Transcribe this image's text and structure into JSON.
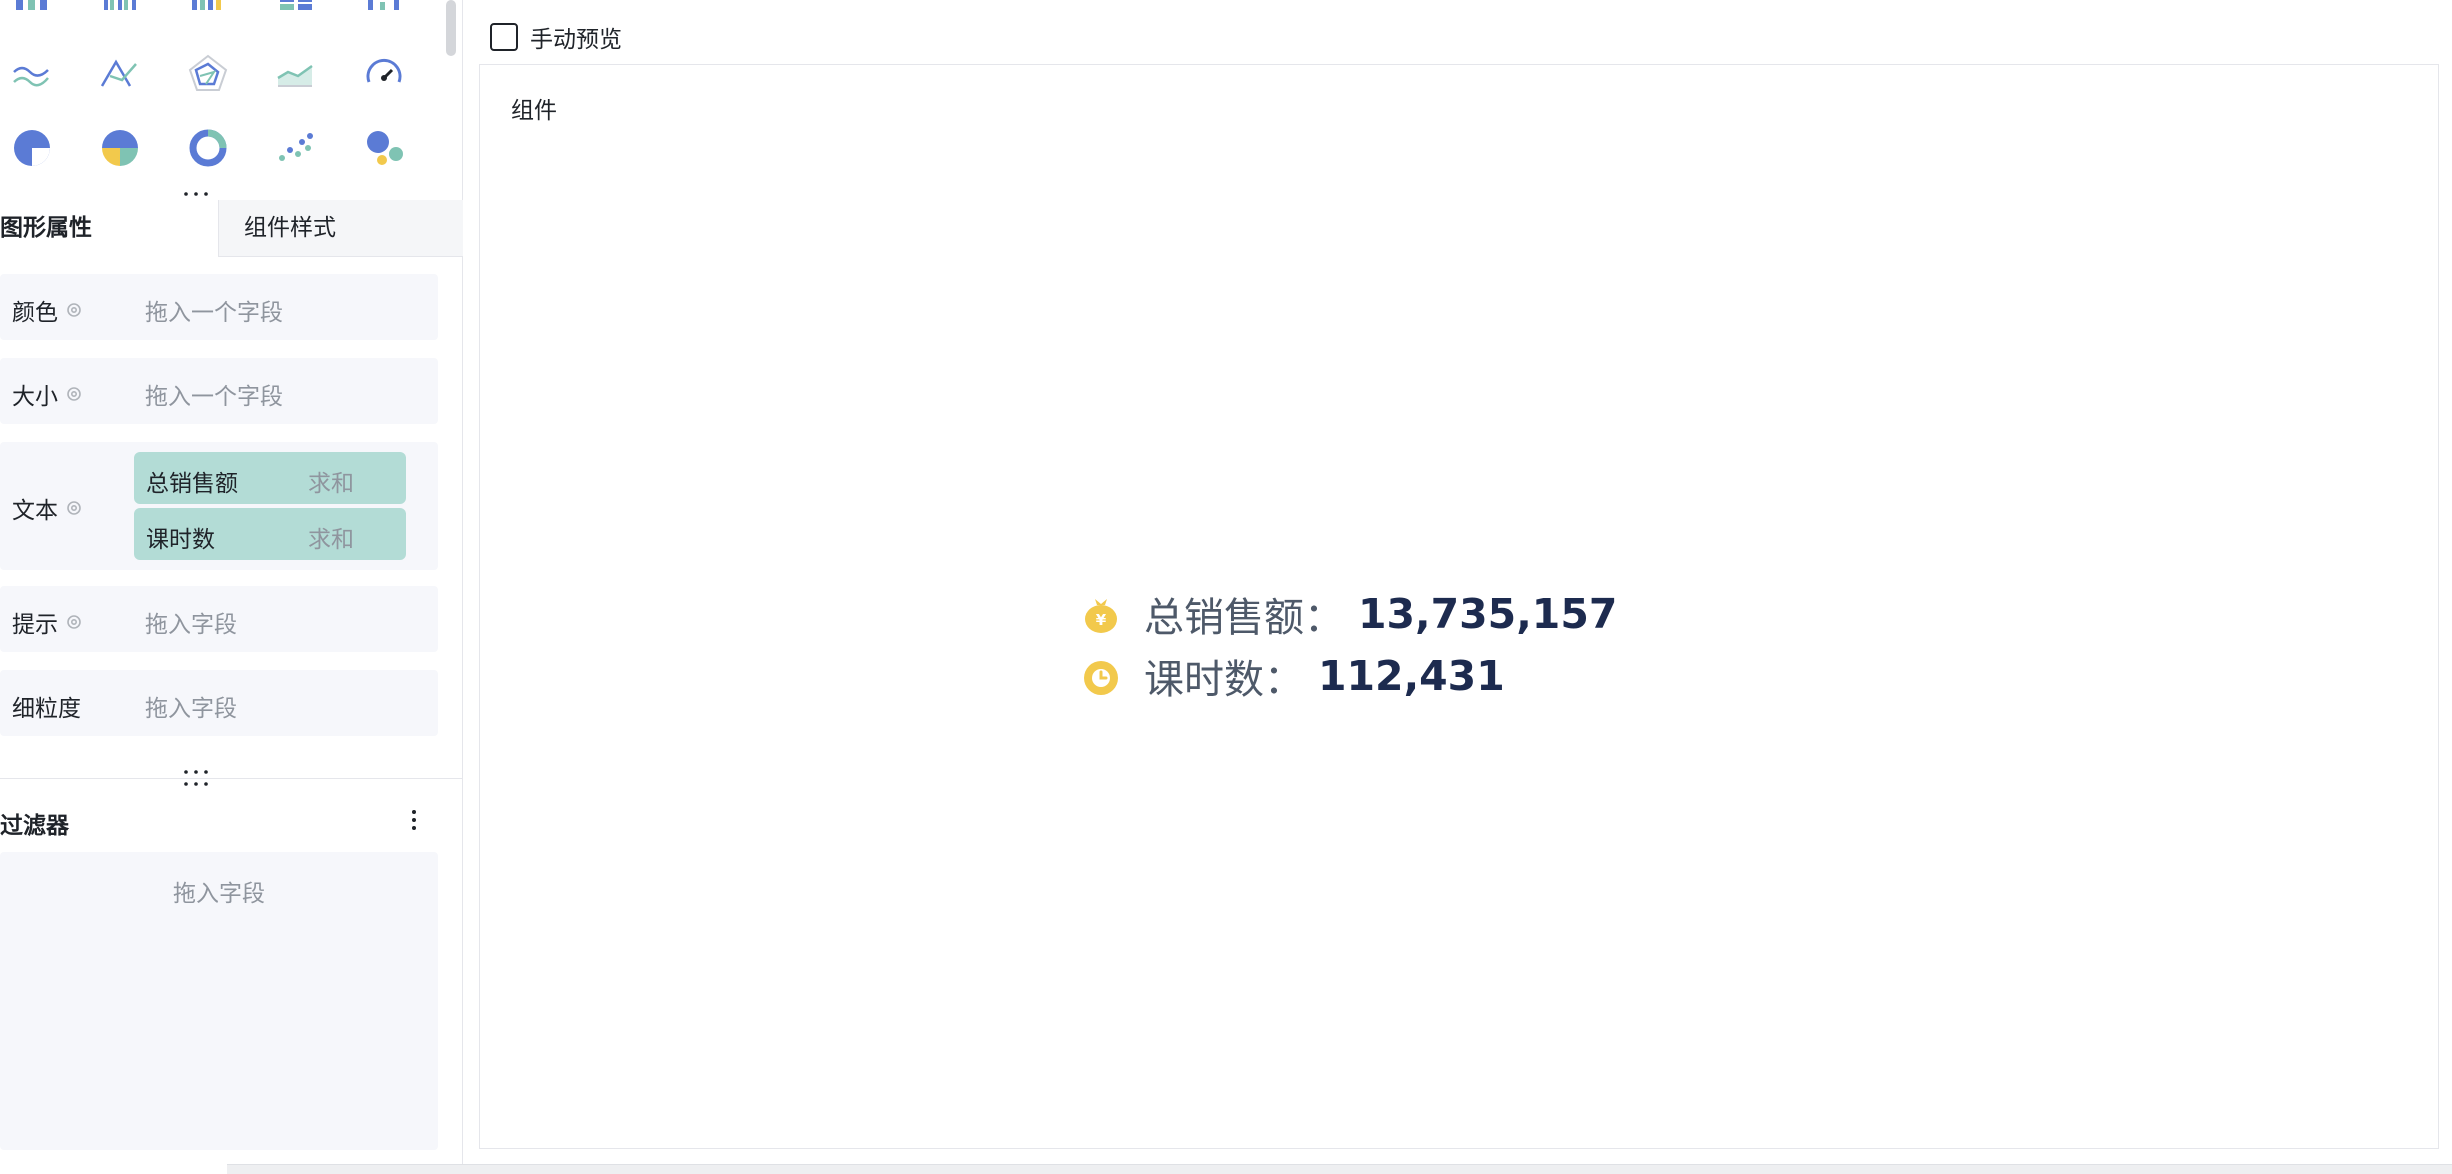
{
  "tabs": {
    "active": "图形属性",
    "inactive": "组件样式"
  },
  "chart_types": [
    "bar-chart-icon",
    "grouped-bar-chart-icon",
    "multi-bar-chart-icon",
    "layout-bar-chart-icon",
    "step-chart-icon",
    "wave-line-chart-icon",
    "cross-line-chart-icon",
    "radar-chart-icon",
    "area-chart-icon",
    "gauge-chart-icon",
    "pie-chart-icon",
    "quadrant-pie-chart-icon",
    "donut-chart-icon",
    "scatter-chart-icon",
    "bubble-chart-icon"
  ],
  "properties": {
    "color": {
      "label": "颜色",
      "placeholder": "拖入一个字段"
    },
    "size": {
      "label": "大小",
      "placeholder": "拖入一个字段"
    },
    "text": {
      "label": "文本",
      "fields": [
        {
          "name": "总销售额",
          "agg": "求和"
        },
        {
          "name": "课时数",
          "agg": "求和"
        }
      ]
    },
    "tooltip": {
      "label": "提示",
      "placeholder": "拖入字段"
    },
    "granularity": {
      "label": "细粒度",
      "placeholder": "拖入字段"
    }
  },
  "filter": {
    "title": "过滤器",
    "placeholder": "拖入字段"
  },
  "preview": {
    "label": "手动预览",
    "checked": false
  },
  "canvas": {
    "component_label": "组件",
    "kpis": [
      {
        "label": "总销售额",
        "colon": "：",
        "value": "13,735,157",
        "icon": "money-bag-icon"
      },
      {
        "label": "课时数",
        "colon": "：",
        "value": "112,431",
        "icon": "clock-icon"
      }
    ]
  },
  "colors": {
    "accent_blue": "#5b7bd5",
    "accent_green": "#7fc3b3",
    "accent_yellow": "#f2c94c",
    "pill_bg": "#b3dcd6",
    "value_text": "#1d2b4f"
  }
}
